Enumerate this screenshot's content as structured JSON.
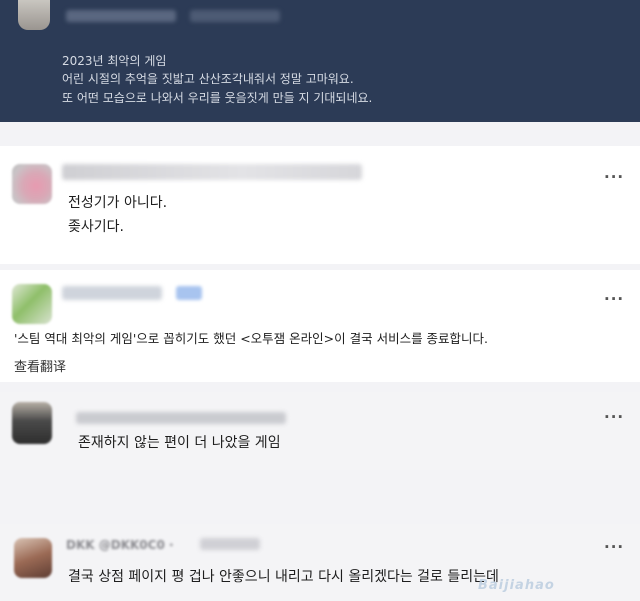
{
  "top_post": {
    "lines": [
      "2023년 최악의 게임",
      "어린 시절의 추억을 짓밟고 산산조각내줘서 정말 고마워요.",
      "또 어떤 모습으로 나와서 우리를 웃음짓게 만들 지 기대되네요."
    ]
  },
  "comments": [
    {
      "lines": [
        "전성기가 아니다.",
        "좆사기다."
      ],
      "more_label": "···"
    },
    {
      "lines": [
        "'스팀 역대 최악의 게임'으로 꼽히기도 했던 <오투잼 온라인>이 결국 서비스를 종료합니다."
      ],
      "translate_label": "查看翻译",
      "more_label": "···"
    },
    {
      "lines": [
        "존재하지 않는 편이 더 나았을 게임"
      ],
      "more_label": "···"
    },
    {
      "handle": "DKK @DKK0C0 ·",
      "lines": [
        "결국 상점 페이지 평 겁나 안좋으니 내리고 다시 올리겠다는 걸로 들리는데"
      ],
      "more_label": "···"
    }
  ],
  "watermark": "Baijiahao",
  "colors": {
    "dark_panel": "#2c3b56",
    "dark_text": "#d6dbe4",
    "light_panel": "#ffffff",
    "gray_panel": "#f4f4f6"
  }
}
